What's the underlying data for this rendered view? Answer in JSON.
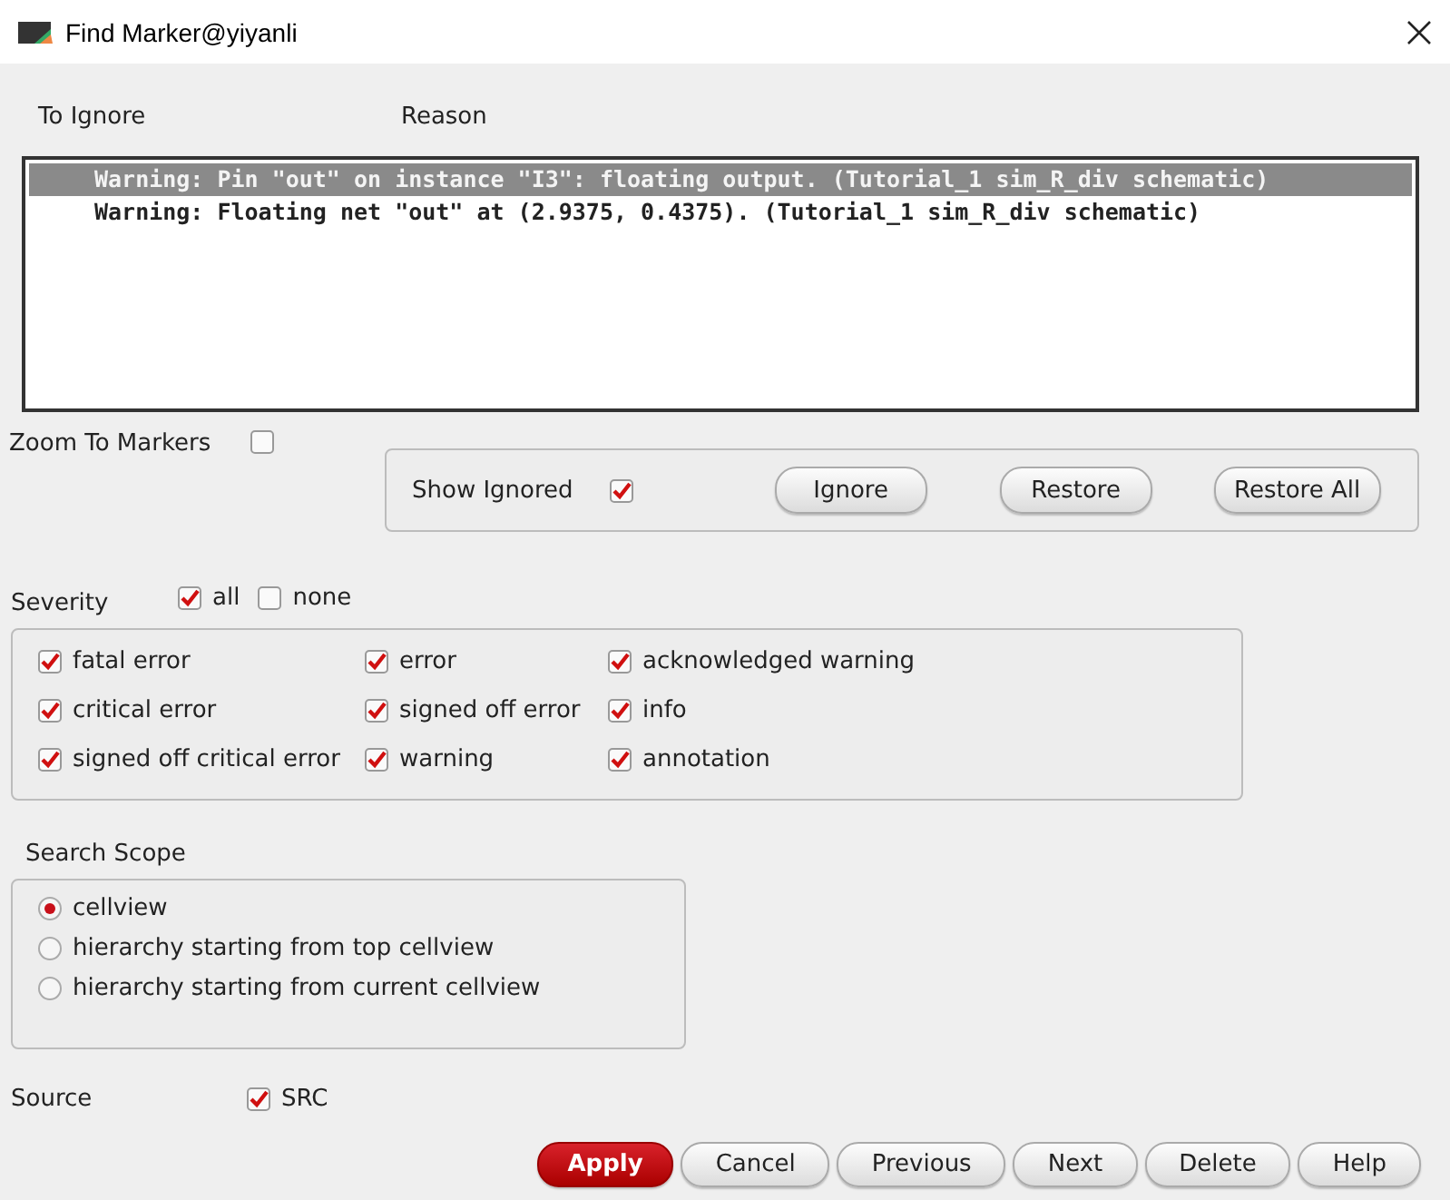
{
  "window": {
    "title": "Find Marker@yiyanli"
  },
  "list": {
    "columns": [
      "To Ignore",
      "Reason"
    ],
    "rows": [
      {
        "text": "Warning: Pin \"out\" on instance \"I3\": floating output. (Tutorial_1 sim_R_div schematic)",
        "selected": true
      },
      {
        "text": "Warning: Floating net \"out\" at (2.9375, 0.4375). (Tutorial_1 sim_R_div schematic)",
        "selected": false
      }
    ]
  },
  "zoom_to_markers": {
    "label": "Zoom To Markers",
    "checked": false
  },
  "show_ignored": {
    "label": "Show Ignored",
    "checked": true
  },
  "list_buttons": [
    "Ignore",
    "Restore",
    "Restore All"
  ],
  "severity": {
    "label": "Severity",
    "all": {
      "label": "all",
      "checked": true
    },
    "none": {
      "label": "none",
      "checked": false
    },
    "columns": [
      [
        {
          "label": "fatal error",
          "checked": true
        },
        {
          "label": "critical error",
          "checked": true
        },
        {
          "label": "signed off critical error",
          "checked": true
        }
      ],
      [
        {
          "label": "error",
          "checked": true
        },
        {
          "label": "signed off error",
          "checked": true
        },
        {
          "label": "warning",
          "checked": true
        }
      ],
      [
        {
          "label": "acknowledged warning",
          "checked": true
        },
        {
          "label": "info",
          "checked": true
        },
        {
          "label": "annotation",
          "checked": true
        }
      ]
    ]
  },
  "search_scope": {
    "label": "Search Scope",
    "options": [
      {
        "label": "cellview",
        "selected": true
      },
      {
        "label": "hierarchy starting from top cellview",
        "selected": false
      },
      {
        "label": "hierarchy starting from current cellview",
        "selected": false
      }
    ]
  },
  "source": {
    "label": "Source",
    "option": {
      "label": "SRC",
      "checked": true
    }
  },
  "buttons": [
    {
      "label": "Apply",
      "kind": "primary"
    },
    {
      "label": "Cancel",
      "kind": "normal"
    },
    {
      "label": "Previous",
      "kind": "normal"
    },
    {
      "label": "Next",
      "kind": "normal"
    },
    {
      "label": "Delete",
      "kind": "normal"
    },
    {
      "label": "Help",
      "kind": "normal"
    }
  ]
}
